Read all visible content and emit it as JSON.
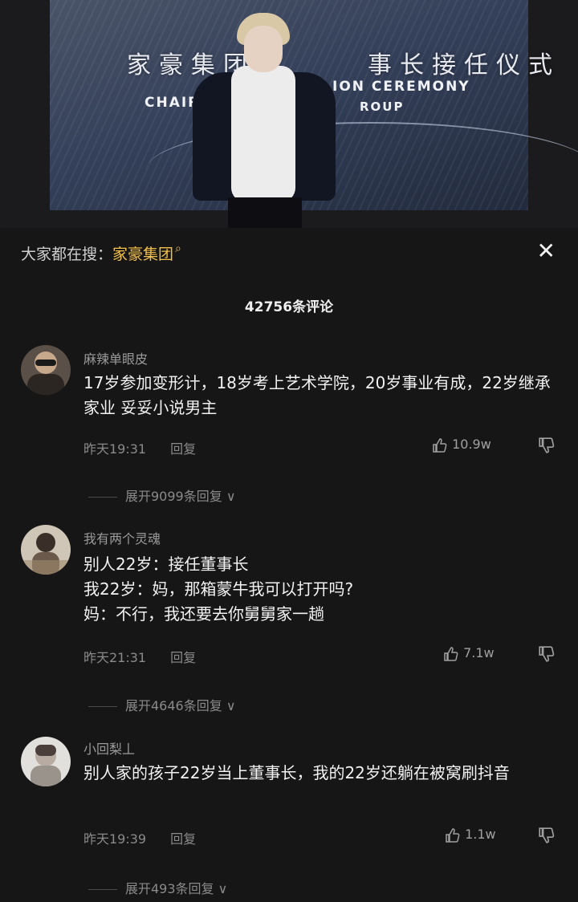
{
  "video": {
    "banner_cn": "家豪集团 ·",
    "banner_cn_tail": "事长接任仪式",
    "banner_en_left": "CHAIRMAN",
    "banner_en_right": "ION CEREMONY",
    "banner_en_line2": "ROUP"
  },
  "header": {
    "search_prefix": "大家都在搜：",
    "search_term": "家豪集团",
    "comment_count": "42756条评论"
  },
  "comments": [
    {
      "username": "麻辣单眼皮",
      "text": "17岁参加变形计，18岁考上艺术学院，20岁事业有成，22岁继承家业 妥妥小说男主",
      "time": "昨天19:31",
      "reply": "回复",
      "likes": "10.9w",
      "expand": "展开9099条回复"
    },
    {
      "username": "我有两个灵魂",
      "text": "别人22岁：接任董事长\n我22岁：妈，那箱蒙牛我可以打开吗?\n妈：不行，我还要去你舅舅家一趟",
      "time": "昨天21:31",
      "reply": "回复",
      "likes": "7.1w",
      "expand": "展开4646条回复"
    },
    {
      "username": "小回梨丄",
      "text": "别人家的孩子22岁当上董事长，我的22岁还躺在被窝刷抖音",
      "time": "昨天19:39",
      "reply": "回复",
      "likes": "1.1w",
      "expand": "展开493条回复"
    }
  ],
  "colors": {
    "background": "#161616",
    "accent": "#f3c04a",
    "text": "#f2f2f2",
    "muted": "#8a8a8a"
  }
}
